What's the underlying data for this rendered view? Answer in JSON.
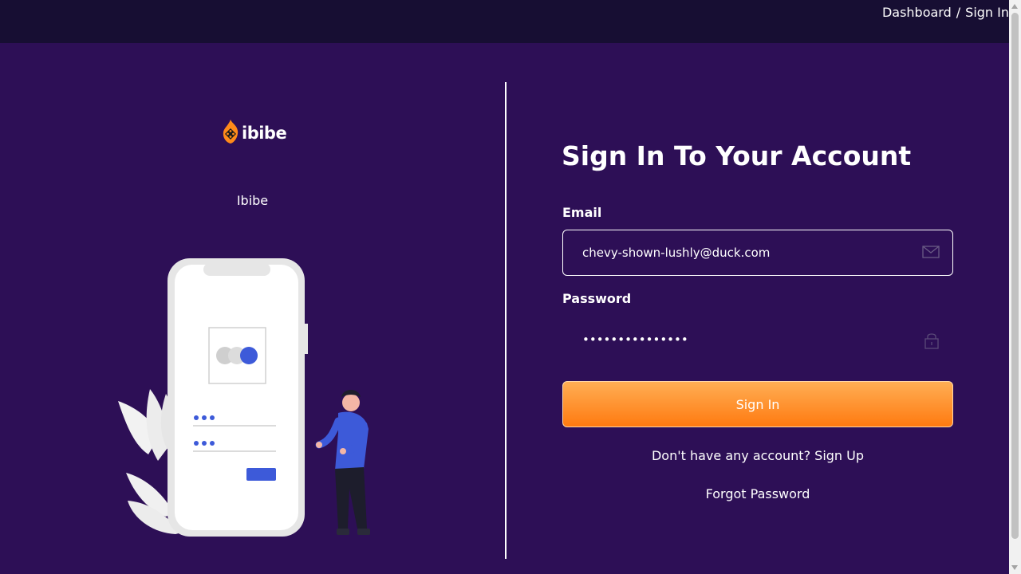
{
  "breadcrumb": {
    "dashboard": "Dashboard",
    "separator": "/",
    "current": "Sign In"
  },
  "brand": {
    "logo_text": "ibibe",
    "name": "Ibibe"
  },
  "form": {
    "title": "Sign In To Your Account",
    "email_label": "Email",
    "email_value": "chevy-shown-lushly@duck.com",
    "password_label": "Password",
    "password_value": "•••••••••••••••",
    "submit_label": "Sign In",
    "signup_prompt": "Don't have any account?",
    "signup_link": "Sign Up",
    "forgot_link": "Forgot Password"
  },
  "icons": {
    "email": "envelope-icon",
    "password": "lock-icon",
    "logo": "dice-flame-icon"
  },
  "colors": {
    "background": "#2d0f56",
    "topbar": "#170e33",
    "accent_top": "#ffae54",
    "accent_bottom": "#ff7a10",
    "illustration_blue": "#3d5ad9"
  }
}
